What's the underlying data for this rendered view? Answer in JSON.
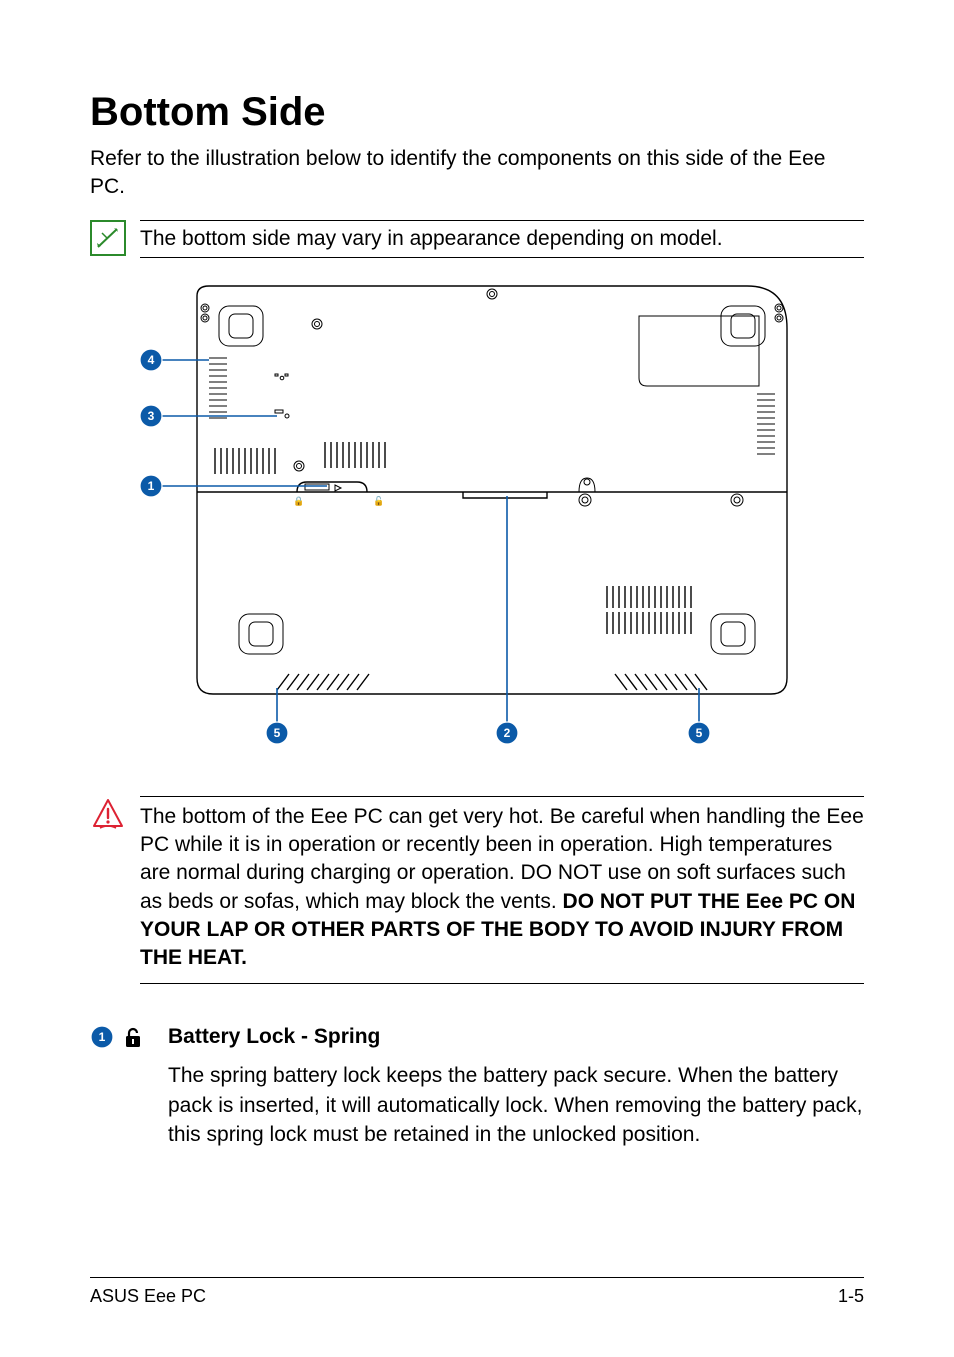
{
  "title": "Bottom Side",
  "intro": "Refer to the illustration below to identify the components on this side of the Eee PC.",
  "note": "The bottom side may vary in appearance depending on model.",
  "warning_part1": "The bottom of the Eee PC can get very hot. Be careful when handling the Eee PC while it is in operation or recently been in operation. High temperatures are normal during charging or operation. DO NOT use on soft surfaces such as beds or sofas, which may block the vents. ",
  "warning_emph": "DO NOT PUT THE Eee PC ON YOUR LAP OR OTHER PARTS OF THE BODY TO AVOID INJURY FROM THE HEAT.",
  "item1": {
    "num": "1",
    "heading": "Battery Lock - Spring",
    "body": "The spring battery lock keeps the battery pack secure. When the battery pack is inserted, it will automatically lock. When removing the battery pack, this spring lock must be retained in the unlocked position."
  },
  "callouts": {
    "c1": "1",
    "c2": "2",
    "c3": "3",
    "c4": "4",
    "c5a": "5",
    "c5b": "5"
  },
  "footer_left": "ASUS Eee PC",
  "footer_right": "1-5"
}
